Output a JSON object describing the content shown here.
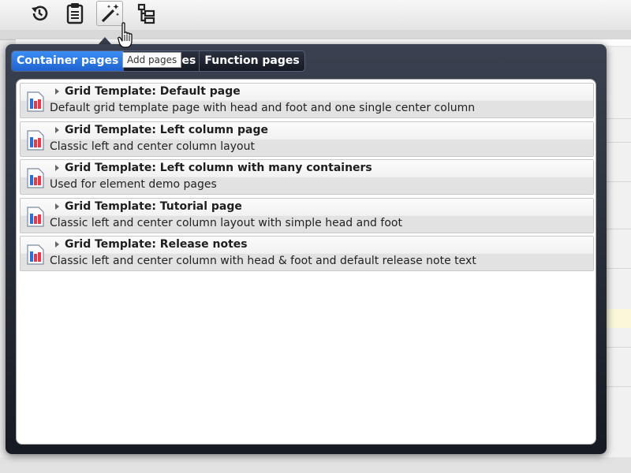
{
  "toolbar": {
    "buttons": [
      {
        "name": "history-icon"
      },
      {
        "name": "clipboard-icon"
      },
      {
        "name": "magic-wand-icon"
      },
      {
        "name": "sitemap-tree-icon"
      }
    ]
  },
  "tooltip": {
    "text": "Add pages"
  },
  "tabs": [
    {
      "label": "Container pages",
      "active": true
    },
    {
      "label": "ges",
      "active": false
    },
    {
      "label": "Function pages",
      "active": false
    }
  ],
  "templates": [
    {
      "title": "Grid Template: Default page",
      "description": "Default grid template page with head and foot and one single center column",
      "icon": "page-template-icon"
    },
    {
      "title": "Grid Template: Left column page",
      "description": "Classic left and center column layout",
      "icon": "page-template-icon"
    },
    {
      "title": "Grid Template: Left column with many containers",
      "description": "Used for element demo pages",
      "icon": "page-template-icon"
    },
    {
      "title": "Grid Template: Tutorial page",
      "description": "Classic left and center column layout with simple head and foot",
      "icon": "page-template-icon"
    },
    {
      "title": "Grid Template: Release notes",
      "description": "Classic left and center column with head & foot and default release note text",
      "icon": "page-template-icon"
    }
  ],
  "colors": {
    "active_tab": "#2f7be6",
    "popup_dark": "#1a1e27"
  }
}
